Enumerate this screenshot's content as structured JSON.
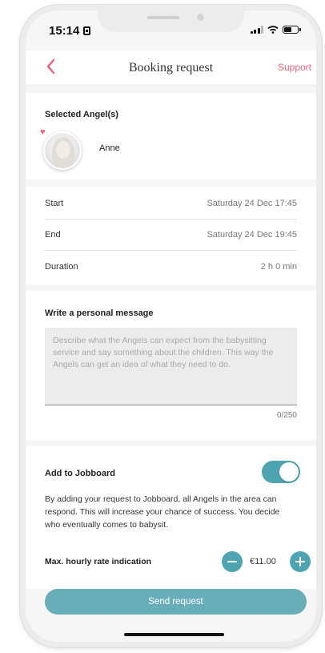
{
  "status_bar": {
    "time": "15:14"
  },
  "nav": {
    "title": "Booking request",
    "support_label": "Support"
  },
  "selected_angels": {
    "title": "Selected Angel(s)",
    "angels": [
      {
        "name": "Anne"
      }
    ]
  },
  "times": {
    "rows": [
      {
        "label": "Start",
        "value": "Saturday 24 Dec 17:45"
      },
      {
        "label": "End",
        "value": "Saturday 24 Dec 19:45"
      },
      {
        "label": "Duration",
        "value": "2 h 0 min"
      }
    ]
  },
  "message": {
    "title": "Write a personal message",
    "placeholder": "Describe what the Angels can expect from the babysitting service and say something about the children. This way the Angels can get an idea of what they need to do.",
    "counter": "0/250"
  },
  "jobboard": {
    "title": "Add to Jobboard",
    "toggle_on": true,
    "description": "By adding your request to Jobboard, all Angels in the area can respond. This will increase your chance of success. You decide who eventually comes to babysit.",
    "rate_label": "Max. hourly rate indication",
    "rate_value": "€11.00"
  },
  "footer": {
    "send_label": "Send request"
  },
  "colors": {
    "accent_pink": "#e8607a",
    "accent_teal": "#4ea4b0",
    "send_button": "#68aeb9"
  }
}
